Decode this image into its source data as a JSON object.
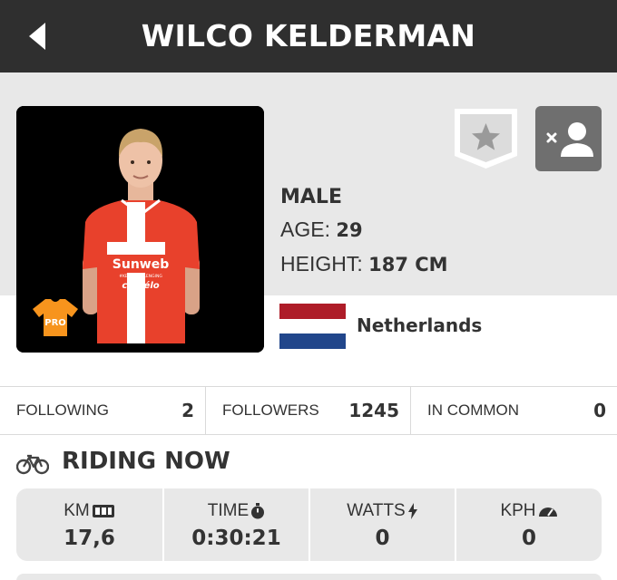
{
  "header": {
    "title": "WILCO KELDERMAN"
  },
  "profile": {
    "gender": "MALE",
    "age_label": "AGE:",
    "age_value": "29",
    "height_label": "HEIGHT:",
    "height_value": "187 CM",
    "country": "Netherlands",
    "badge": "PRO"
  },
  "jersey": {
    "sponsor": "Sunweb",
    "tagline": "#KEEPCHALLENGING",
    "bike_brand": "cervélo"
  },
  "stats": {
    "following_label": "FOLLOWING",
    "following_value": "2",
    "followers_label": "FOLLOWERS",
    "followers_value": "1245",
    "common_label": "IN COMMON",
    "common_value": "0"
  },
  "riding": {
    "title": "RIDING NOW",
    "metrics": [
      {
        "label": "KM",
        "value": "17,6",
        "icon": "odometer-icon"
      },
      {
        "label": "TIME",
        "value": "0:30:21",
        "icon": "stopwatch-icon"
      },
      {
        "label": "WATTS",
        "value": "0",
        "icon": "lightning-icon"
      },
      {
        "label": "KPH",
        "value": "0",
        "icon": "speedometer-icon"
      }
    ]
  },
  "colors": {
    "header_bg": "#2f2f2f",
    "panel_bg": "#e8e8e8",
    "jersey_red": "#e8412c",
    "pro_orange": "#f7941d",
    "flag_red": "#ae1c28",
    "flag_blue": "#21468b"
  }
}
